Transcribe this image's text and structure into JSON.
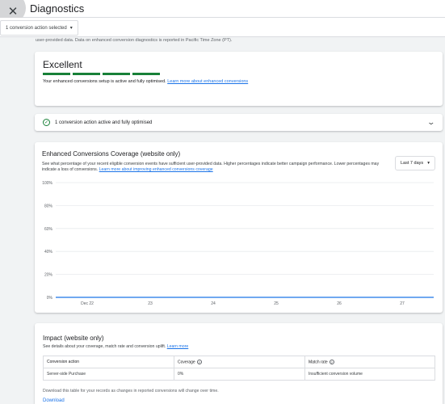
{
  "header": {
    "title": "Diagnostics",
    "close_icon": "close-icon"
  },
  "filter": {
    "label": "1 conversion action selected"
  },
  "intro_text": "user-provided data. Data on enhanced conversion diagnostics is reported in Pacific Time Zone (PT).",
  "status": {
    "title": "Excellent",
    "bar_count": 4,
    "text": "Your enhanced conversions setup is active and fully optimised.",
    "link": "Learn more about enhanced conversions",
    "color": "#188038"
  },
  "summary_row": {
    "text": "1 conversion action active and fully optimised"
  },
  "coverage": {
    "title": "Enhanced Conversions Coverage (website only)",
    "desc": "See what percentage of your recent eligible conversion events have sufficient user-provided data. Higher percentages indicate better campaign performance. Lower percentages may indicate a loss of conversions.",
    "link": "Learn more about improving enhanced conversions coverage",
    "range": "Last 7 days"
  },
  "chart_data": {
    "type": "line",
    "x": [
      "Dec 22",
      "23",
      "24",
      "25",
      "26",
      "27"
    ],
    "series": [
      {
        "values": [
          0,
          0,
          0,
          0,
          0,
          0,
          0
        ]
      }
    ],
    "y_ticks": [
      "100%",
      "80%",
      "60%",
      "40%",
      "20%",
      "0%"
    ],
    "ylim": [
      0,
      100
    ],
    "line_color": "#1a73e8",
    "grid": true
  },
  "impact": {
    "title": "Impact (website only)",
    "desc": "See details about your coverage, match rate and conversion uplift.",
    "link": "Learn more",
    "headers": [
      "Conversion action",
      "Coverage",
      "Match rate"
    ],
    "rows": [
      [
        "Server-side Purchase",
        "0%",
        "Insufficient conversion volume"
      ]
    ],
    "note": "Download this table for your records as changes in reported conversions will change over time.",
    "download": "Download"
  }
}
